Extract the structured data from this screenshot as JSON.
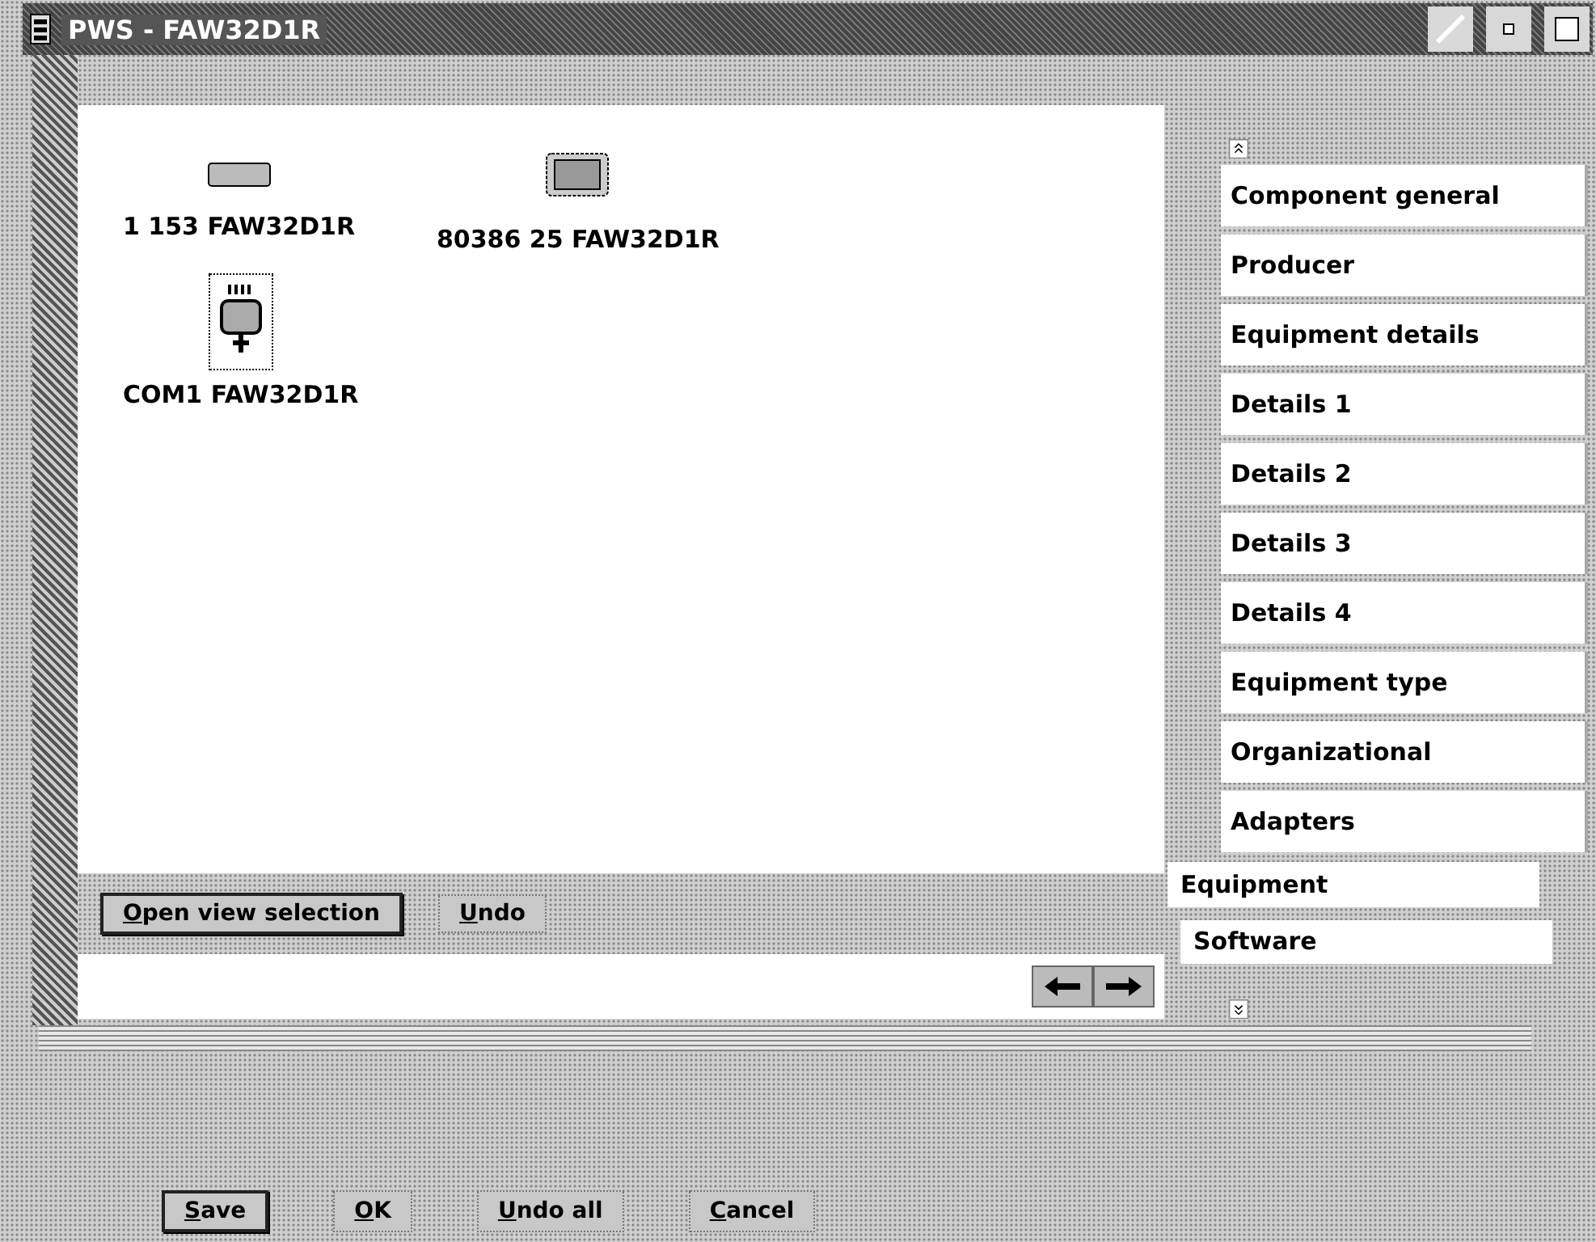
{
  "window": {
    "title": "PWS - FAW32D1R"
  },
  "objects": [
    {
      "kind": "drive",
      "label": "1 153 FAW32D1R",
      "selected": false
    },
    {
      "kind": "chip",
      "label": "80386 25 FAW32D1R",
      "selected": false
    },
    {
      "kind": "port",
      "label": "COM1 FAW32D1R",
      "selected": true
    }
  ],
  "page_buttons": [
    {
      "label": "Open view selection",
      "default": true
    },
    {
      "label": "Undo",
      "default": false
    }
  ],
  "minor_tabs": [
    {
      "label": "Component general",
      "selected": false
    },
    {
      "label": "Producer",
      "selected": false
    },
    {
      "label": "Equipment details",
      "selected": false
    },
    {
      "label": "Details 1",
      "selected": false
    },
    {
      "label": "Details 2",
      "selected": false
    },
    {
      "label": "Details 3",
      "selected": false
    },
    {
      "label": "Details 4",
      "selected": false
    },
    {
      "label": "Equipment type",
      "selected": false
    },
    {
      "label": "Organizational",
      "selected": false
    },
    {
      "label": "Adapters",
      "selected": false
    }
  ],
  "major_tabs": [
    {
      "label": "Equipment",
      "selected": true
    },
    {
      "label": "Software",
      "selected": false
    }
  ],
  "dialog_buttons": [
    {
      "label": "Save",
      "default": true
    },
    {
      "label": "OK",
      "default": false
    },
    {
      "label": "Undo all",
      "default": false
    },
    {
      "label": "Cancel",
      "default": false
    }
  ]
}
